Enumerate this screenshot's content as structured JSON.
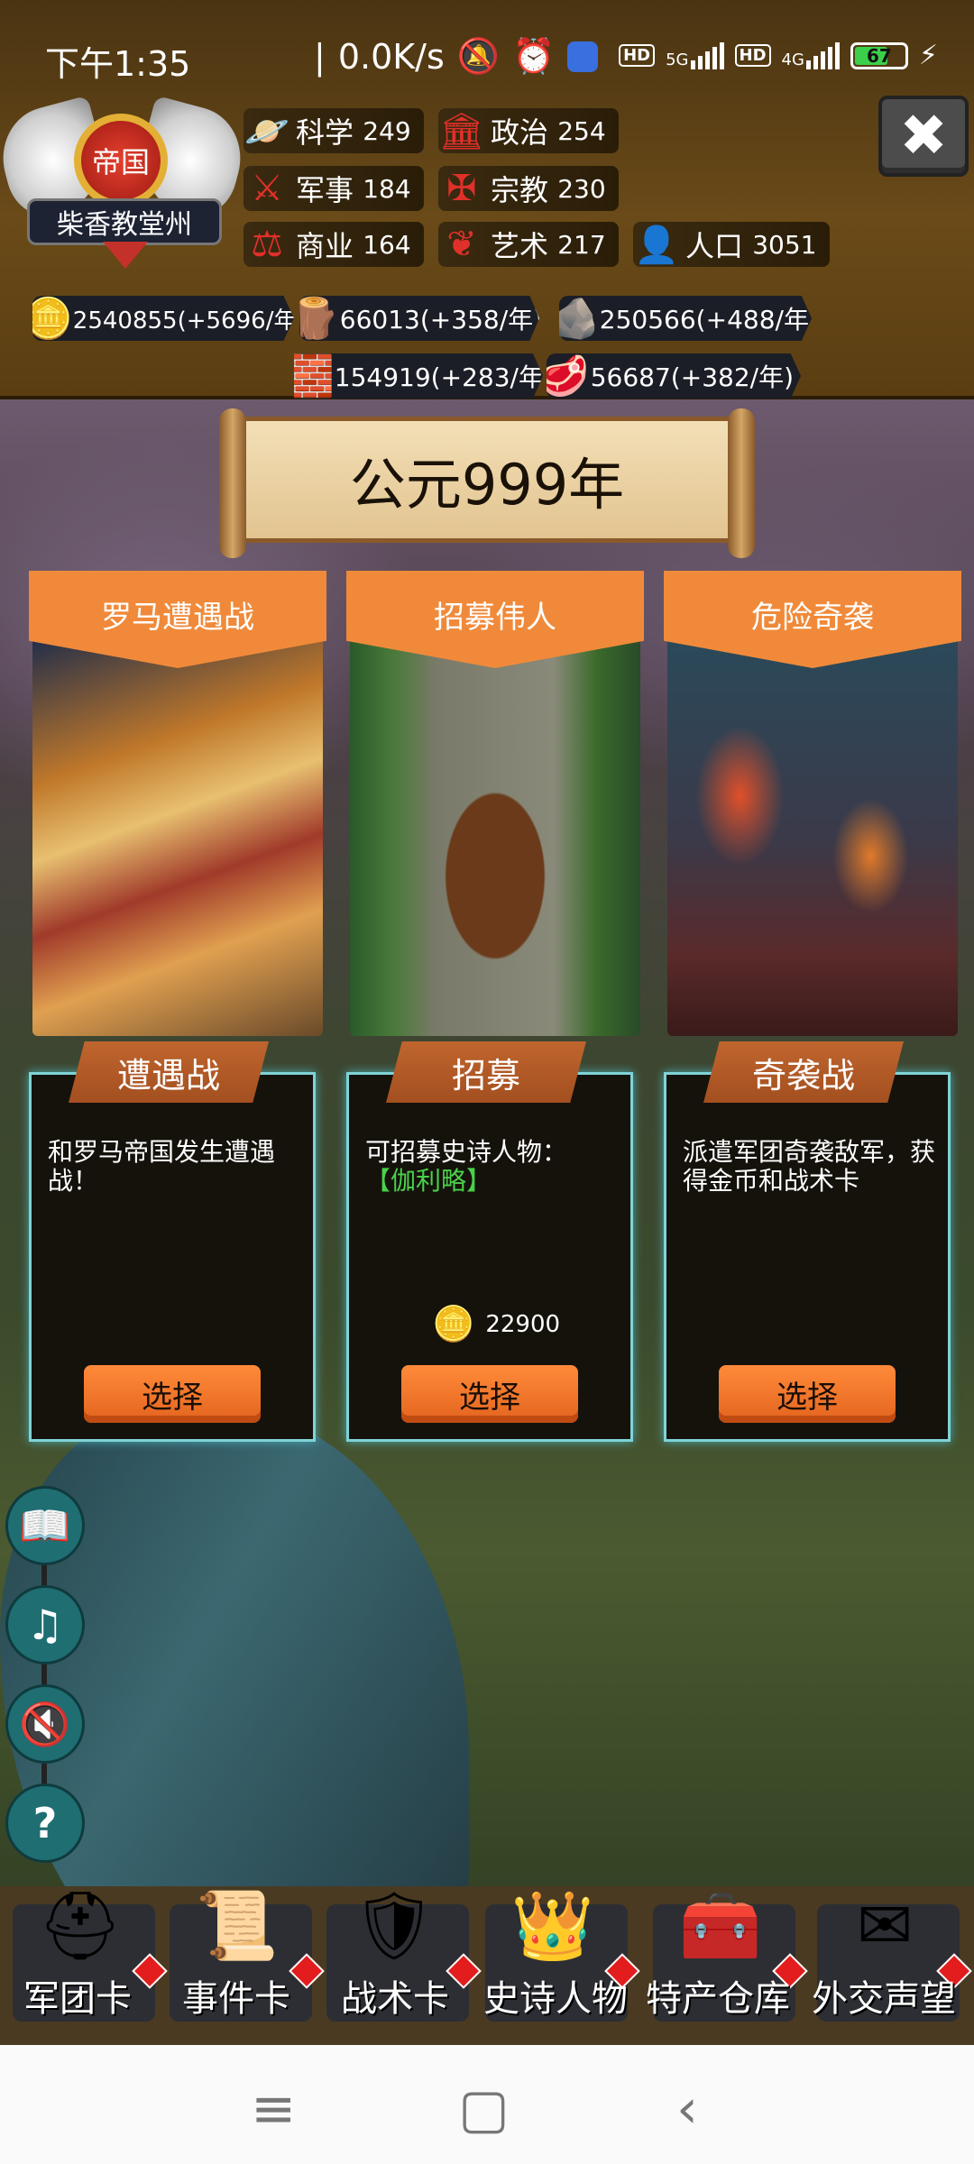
{
  "status_bar": {
    "time": "下午1:35",
    "speed": "0.0K/s",
    "net1": "HD",
    "net1_gen": "5G",
    "net2": "HD",
    "net2_gen": "4G",
    "battery": "67"
  },
  "emblem": {
    "title": "帝国",
    "region": "柴香教堂州"
  },
  "stats": [
    {
      "icon": "science-icon",
      "label": "科学",
      "value": "249"
    },
    {
      "icon": "politics-icon",
      "label": "政治",
      "value": "254"
    },
    {
      "icon": "military-icon",
      "label": "军事",
      "value": "184"
    },
    {
      "icon": "religion-icon",
      "label": "宗教",
      "value": "230"
    },
    {
      "icon": "commerce-icon",
      "label": "商业",
      "value": "164"
    },
    {
      "icon": "art-icon",
      "label": "艺术",
      "value": "217"
    },
    {
      "icon": "population-icon",
      "label": "人口",
      "value": "3051"
    }
  ],
  "resources": [
    {
      "icon": "gold-icon",
      "text": "2540855(+5696/年"
    },
    {
      "icon": "wood-icon",
      "text": "66013(+358/年)"
    },
    {
      "icon": "stone-icon",
      "text": "250566(+488/年)"
    },
    {
      "icon": "iron-icon",
      "text": "154919(+283/年)"
    },
    {
      "icon": "meat-icon",
      "text": "56687(+382/年)"
    }
  ],
  "year": "公元999年",
  "cards": [
    {
      "header": "罗马遭遇战",
      "tab": "遭遇战",
      "desc": "和罗马帝国发生遭遇战！",
      "button": "选择"
    },
    {
      "header": "招募伟人",
      "tab": "招募",
      "desc": "可招募史诗人物：",
      "desc_hl": "【伽利略】",
      "cost": "22900",
      "button": "选择"
    },
    {
      "header": "危险奇袭",
      "tab": "奇袭战",
      "desc": "派遣军团奇袭敌军，获得金币和战术卡",
      "button": "选择"
    }
  ],
  "toolbar": [
    {
      "label": "军团卡",
      "icon": "helmet-icon"
    },
    {
      "label": "事件卡",
      "icon": "scroll-icon"
    },
    {
      "label": "战术卡",
      "icon": "shield-swords-icon"
    },
    {
      "label": "史诗人物",
      "icon": "crown-icon"
    },
    {
      "label": "特产仓库",
      "icon": "chest-icon"
    },
    {
      "label": "外交声望",
      "icon": "letter-icon"
    }
  ]
}
